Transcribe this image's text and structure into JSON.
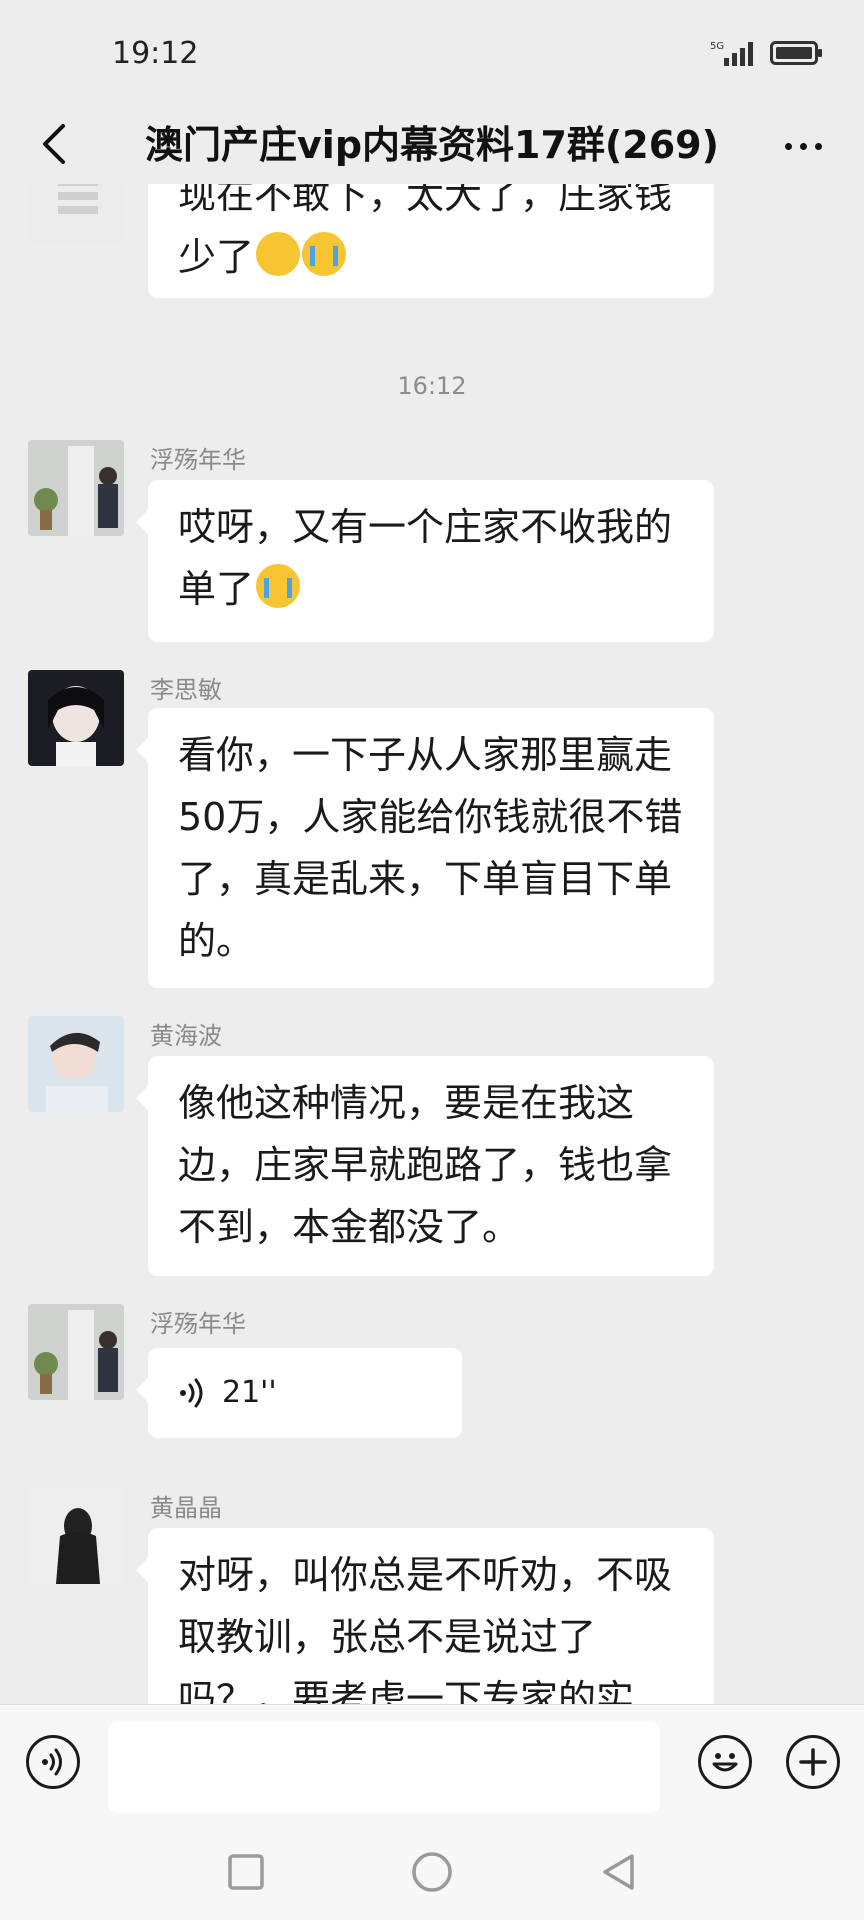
{
  "status_bar": {
    "time": "19:12",
    "network": "5G"
  },
  "header": {
    "title": "澳门产庄vip内幕资料17群(269)"
  },
  "messages": [
    {
      "type": "text",
      "sender": "",
      "text": "现在不敢下，太大了，庄家钱少了",
      "emojis": [
        "thinking-emoji",
        "laughing-crying-emoji"
      ]
    },
    {
      "type": "timestamp",
      "text": "16:12"
    },
    {
      "type": "text",
      "sender": "浮殇年华",
      "text": "哎呀，又有一个庄家不收我的单了",
      "emojis": [
        "crying-emoji"
      ]
    },
    {
      "type": "text",
      "sender": "李思敏",
      "text": "看你，一下子从人家那里赢走50万，人家能给你钱就很不错了，真是乱来，下单盲目下单的。"
    },
    {
      "type": "text",
      "sender": "黄海波",
      "text": "像他这种情况，要是在我这边，庄家早就跑路了，钱也拿不到，本金都没了。"
    },
    {
      "type": "voice",
      "sender": "浮殇年华",
      "duration": "21''"
    },
    {
      "type": "text",
      "sender": "黄晶晶",
      "text": "对呀，叫你总是不听劝，不吸取教训，张总不是说过了吗？，要考虑一下专家的实"
    }
  ],
  "input_bar": {
    "placeholder": ""
  },
  "colors": {
    "background": "#ededed",
    "bubble": "#ffffff",
    "sender": "#8a8a8a"
  }
}
